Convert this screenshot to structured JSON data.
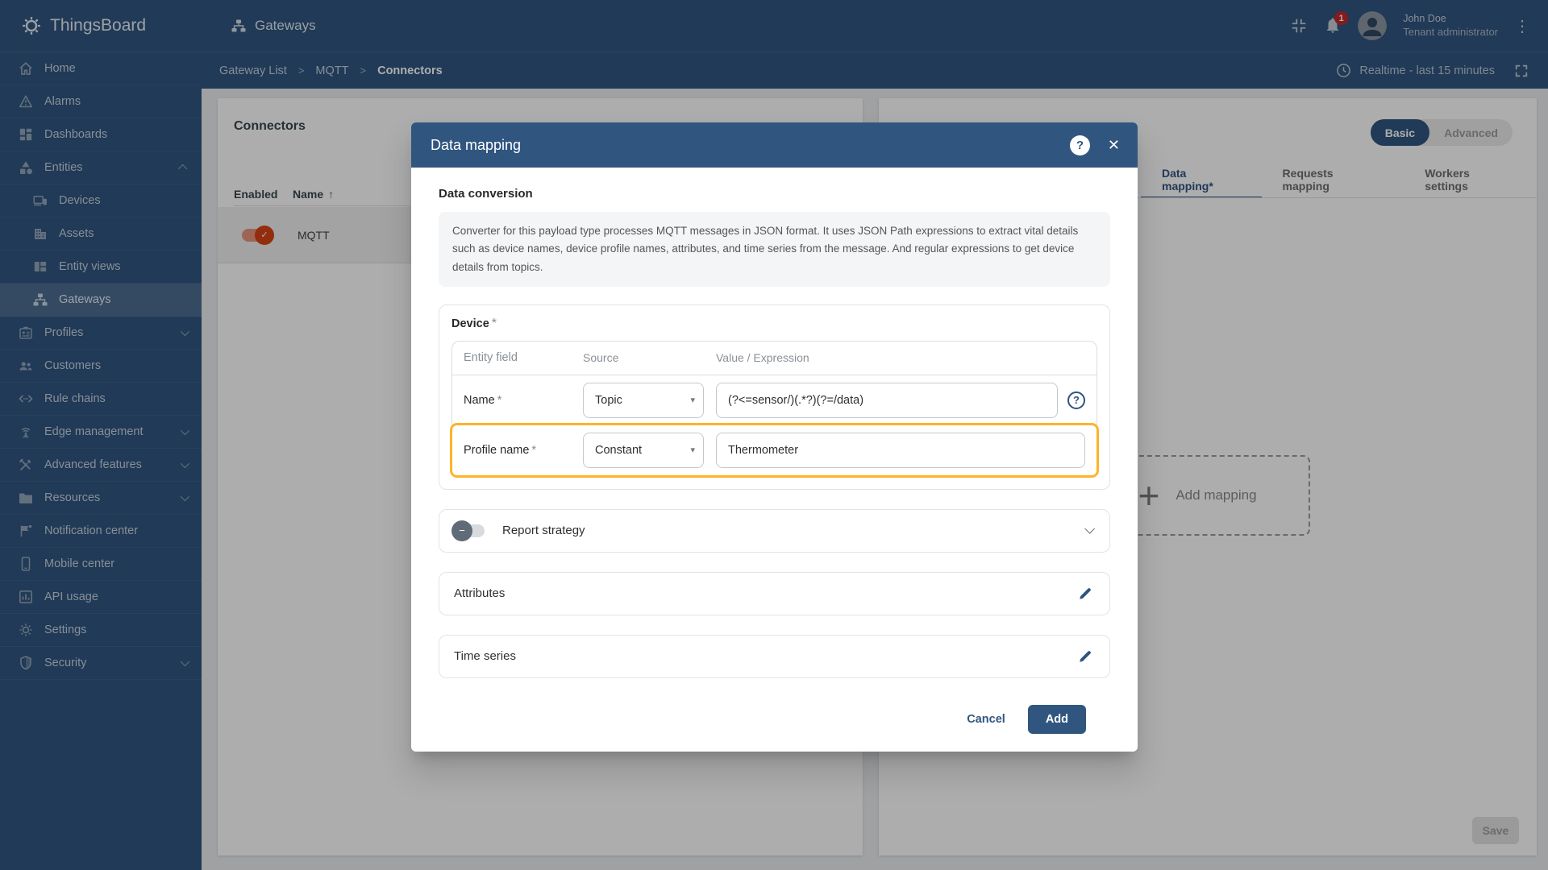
{
  "app": {
    "name": "ThingsBoard",
    "page_title": "Gateways"
  },
  "topbar": {
    "user_name": "John Doe",
    "user_role": "Tenant administrator",
    "notification_count": "1"
  },
  "breadcrumb": {
    "separator": ">",
    "items": [
      {
        "label": "Gateway List"
      },
      {
        "label": "MQTT"
      },
      {
        "label": "Connectors"
      }
    ],
    "realtime_label": "Realtime - last 15 minutes"
  },
  "sidebar": {
    "items": [
      {
        "label": "Home"
      },
      {
        "label": "Alarms"
      },
      {
        "label": "Dashboards"
      },
      {
        "label": "Entities"
      },
      {
        "label": "Devices"
      },
      {
        "label": "Assets"
      },
      {
        "label": "Entity views"
      },
      {
        "label": "Gateways"
      },
      {
        "label": "Profiles"
      },
      {
        "label": "Customers"
      },
      {
        "label": "Rule chains"
      },
      {
        "label": "Edge management"
      },
      {
        "label": "Advanced features"
      },
      {
        "label": "Resources"
      },
      {
        "label": "Notification center"
      },
      {
        "label": "Mobile center"
      },
      {
        "label": "API usage"
      },
      {
        "label": "Settings"
      },
      {
        "label": "Security"
      }
    ]
  },
  "connectors_panel": {
    "title": "Connectors",
    "columns": {
      "enabled": "Enabled",
      "name": "Name"
    },
    "rows": [
      {
        "name": "MQTT",
        "enabled": true
      }
    ]
  },
  "right_panel": {
    "mode_toggle": {
      "basic": "Basic",
      "advanced": "Advanced",
      "selected": "Basic"
    },
    "tabs": [
      {
        "label": "Data mapping*",
        "active": true
      },
      {
        "label": "Requests mapping",
        "active": false
      },
      {
        "label": "Workers settings",
        "active": false
      }
    ],
    "add_mapping_label": "Add mapping",
    "save_label": "Save"
  },
  "modal": {
    "title": "Data mapping",
    "section_title": "Data conversion",
    "description": "Converter for this payload type processes MQTT messages in JSON format. It uses JSON Path expressions to extract vital details such as device names, device profile names, attributes, and time series from the message. And regular expressions to get device details from topics.",
    "required_mark": "*",
    "device": {
      "title": "Device",
      "columns": {
        "field": "Entity field",
        "source": "Source",
        "value": "Value / Expression"
      },
      "rows": [
        {
          "field": "Name",
          "source": "Topic",
          "value": "(?<=sensor/)(.*?)(?=/data)",
          "highlighted": false
        },
        {
          "field": "Profile name",
          "source": "Constant",
          "value": "Thermometer",
          "highlighted": true
        }
      ]
    },
    "report_strategy_label": "Report strategy",
    "attributes_label": "Attributes",
    "time_series_label": "Time series",
    "cancel_label": "Cancel",
    "add_label": "Add"
  },
  "icons": {
    "close": "✕",
    "help": "?",
    "plus": "+",
    "dots": "⋮",
    "minus": "−",
    "check": "✓",
    "sort_arrow": "↑",
    "dropdown_arrow": "▾"
  },
  "colors": {
    "primary": "#305680",
    "highlight_orange": "#FFB329",
    "toggle_red": "#D84315",
    "badge_red": "#C62828",
    "overlay": "rgba(0,0,0,0.32)"
  }
}
